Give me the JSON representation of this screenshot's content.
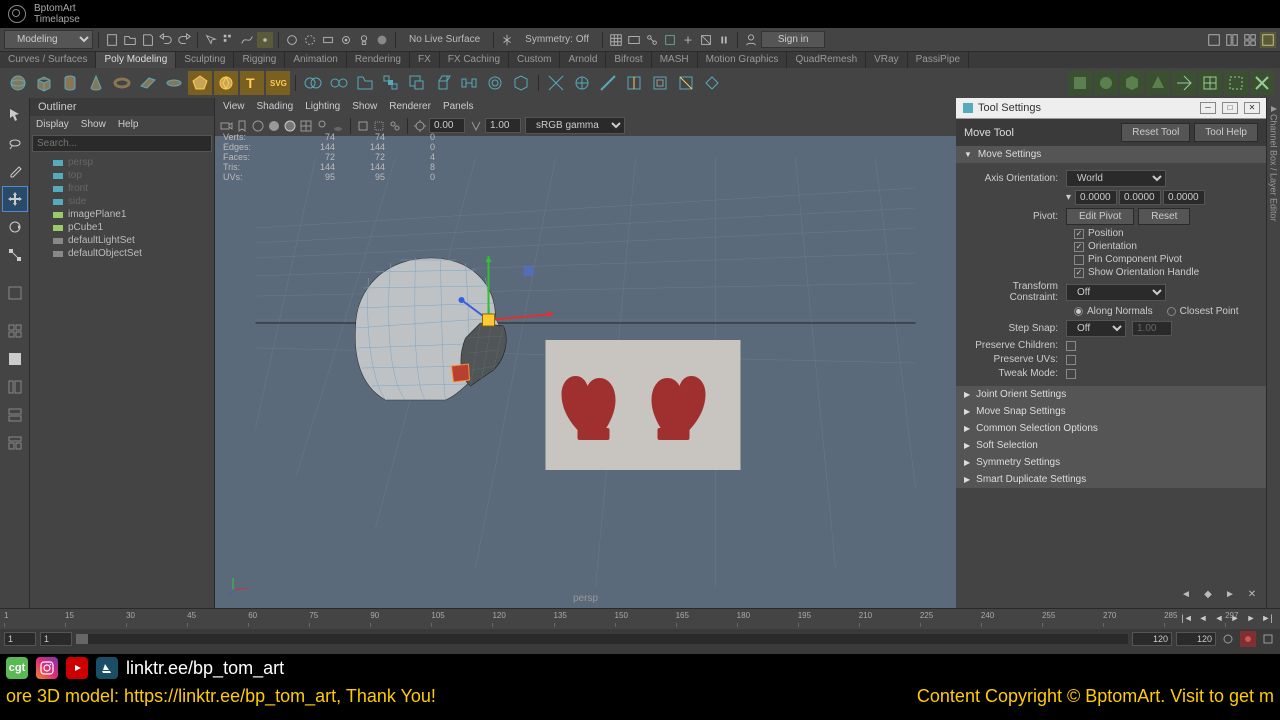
{
  "title": {
    "line1": "BptomArt",
    "line2": "Timelapse"
  },
  "workspace": "Modeling",
  "live_surface": "No Live Surface",
  "symmetry": "Symmetry: Off",
  "signin": "Sign in",
  "shelf_tabs": [
    "Curves / Surfaces",
    "Poly Modeling",
    "Sculpting",
    "Rigging",
    "Animation",
    "Rendering",
    "FX",
    "FX Caching",
    "Custom",
    "Arnold",
    "Bifrost",
    "MASH",
    "Motion Graphics",
    "QuadRemesh",
    "VRay",
    "PassiPipe"
  ],
  "shelf_active": 1,
  "outliner": {
    "title": "Outliner",
    "menu": [
      "Display",
      "Show",
      "Help"
    ],
    "search_placeholder": "Search...",
    "items": [
      {
        "name": "persp",
        "dim": true,
        "type": "camera"
      },
      {
        "name": "top",
        "dim": true,
        "type": "camera"
      },
      {
        "name": "front",
        "dim": true,
        "type": "camera"
      },
      {
        "name": "side",
        "dim": true,
        "type": "camera"
      },
      {
        "name": "imagePlane1",
        "dim": false,
        "type": "plane"
      },
      {
        "name": "pCube1",
        "dim": false,
        "type": "mesh"
      },
      {
        "name": "defaultLightSet",
        "dim": false,
        "type": "set"
      },
      {
        "name": "defaultObjectSet",
        "dim": false,
        "type": "set"
      }
    ]
  },
  "viewport": {
    "menu": [
      "View",
      "Shading",
      "Lighting",
      "Show",
      "Renderer",
      "Panels"
    ],
    "exposure": "0.00",
    "gamma": "1.00",
    "colorspace": "sRGB gamma",
    "name": "persp",
    "hud": [
      {
        "label": "Verts:",
        "v1": "74",
        "v2": "74",
        "v3": "0"
      },
      {
        "label": "Edges:",
        "v1": "144",
        "v2": "144",
        "v3": "0"
      },
      {
        "label": "Faces:",
        "v1": "72",
        "v2": "72",
        "v3": "4"
      },
      {
        "label": "Tris:",
        "v1": "144",
        "v2": "144",
        "v3": "8"
      },
      {
        "label": "UVs:",
        "v1": "95",
        "v2": "95",
        "v3": "0"
      }
    ]
  },
  "tool_settings": {
    "window_title": "Tool Settings",
    "tool_name": "Move Tool",
    "reset_btn": "Reset Tool",
    "help_btn": "Tool Help",
    "sections": {
      "move_settings": "Move Settings",
      "joint": "Joint Orient Settings",
      "snap": "Move Snap Settings",
      "common": "Common Selection Options",
      "soft": "Soft Selection",
      "sym": "Symmetry Settings",
      "dup": "Smart Duplicate Settings"
    },
    "axis_label": "Axis Orientation:",
    "axis_value": "World",
    "coords": [
      "0.0000",
      "0.0000",
      "0.0000"
    ],
    "pivot_label": "Pivot:",
    "edit_pivot": "Edit Pivot",
    "reset_pivot": "Reset",
    "chk_position": "Position",
    "chk_orientation": "Orientation",
    "chk_pin": "Pin Component Pivot",
    "chk_handle": "Show Orientation Handle",
    "tc_label": "Transform Constraint:",
    "tc_value": "Off",
    "along_normals": "Along Normals",
    "closest_point": "Closest Point",
    "step_label": "Step Snap:",
    "step_value": "Off",
    "step_num": "1.00",
    "preserve_children": "Preserve Children:",
    "preserve_uvs": "Preserve UVs:",
    "tweak_mode": "Tweak Mode:"
  },
  "right_tab": "Channel Box / Layer Editor",
  "timeline": {
    "ticks": [
      "1",
      "15",
      "30",
      "45",
      "60",
      "75",
      "90",
      "105",
      "120",
      "135",
      "150",
      "165",
      "180",
      "195",
      "210",
      "225",
      "240",
      "255",
      "270",
      "285",
      "297"
    ],
    "start": "1",
    "range_start": "1",
    "range_end": "120",
    "end": "120"
  },
  "social": {
    "link": "linktr.ee/bp_tom_art"
  },
  "scroll": {
    "left": "ore 3D model: https://linktr.ee/bp_tom_art, Thank You!",
    "right": "Content Copyright © BptomArt. Visit to get m"
  }
}
